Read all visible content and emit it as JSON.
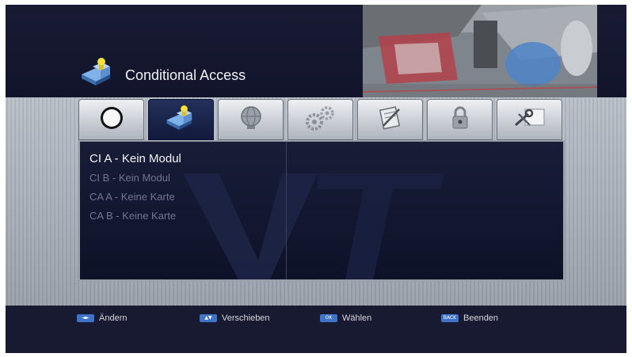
{
  "header": {
    "title": "Conditional Access",
    "title_icon": "conditional-access-icon"
  },
  "tabs": [
    {
      "icon": "circle-icon",
      "active": false
    },
    {
      "icon": "conditional-access-icon",
      "active": true
    },
    {
      "icon": "globe-icon",
      "active": false
    },
    {
      "icon": "gears-icon",
      "active": false
    },
    {
      "icon": "edit-document-icon",
      "active": false
    },
    {
      "icon": "lock-icon",
      "active": false
    },
    {
      "icon": "tools-icon",
      "active": false
    }
  ],
  "menu": {
    "items": [
      {
        "label": "CI A - Kein Modul",
        "selected": true
      },
      {
        "label": "CI B - Kein Modul",
        "selected": false
      },
      {
        "label": "CA A - Keine Karte",
        "selected": false
      },
      {
        "label": "CA B - Keine Karte",
        "selected": false
      }
    ]
  },
  "footer": {
    "hints": [
      {
        "key": "◄►",
        "label": "Ändern"
      },
      {
        "key": "▲▼",
        "label": "Verschieben"
      },
      {
        "key": "OK",
        "label": "Wählen"
      },
      {
        "key": "BACK",
        "label": "Beenden"
      }
    ]
  },
  "colors": {
    "background": "#13162c",
    "accent_blue": "#3f73c8",
    "selected_text": "#f4f4f4",
    "dim_text": "#6f7690"
  }
}
